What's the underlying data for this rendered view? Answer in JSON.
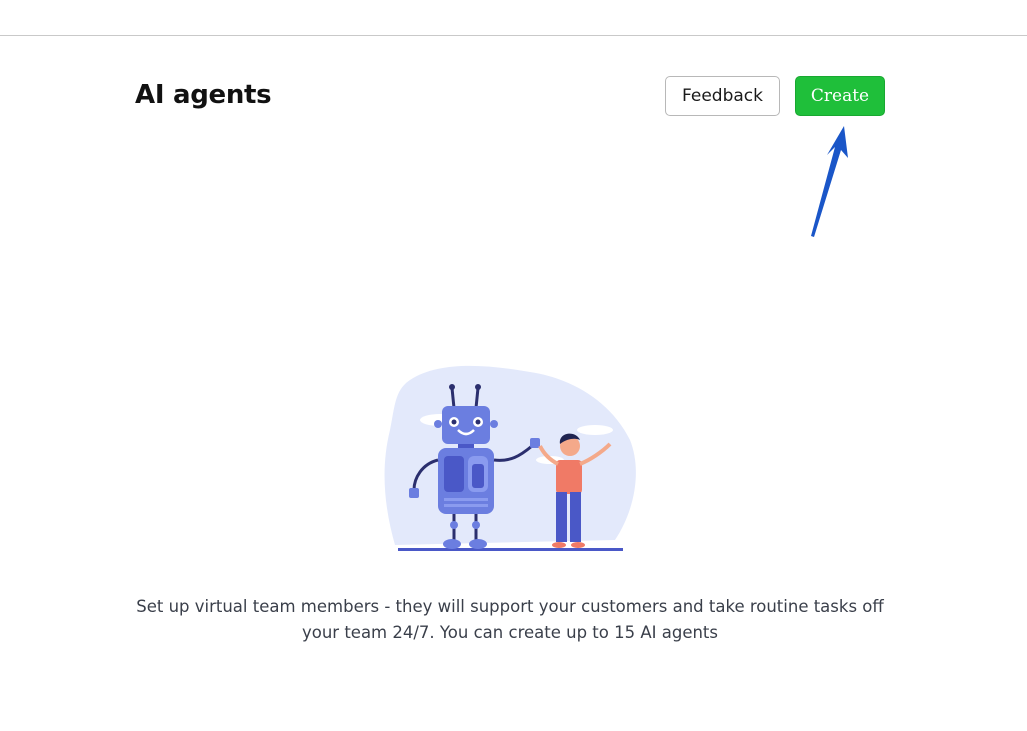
{
  "header": {
    "title": "AI agents",
    "feedback_label": "Feedback",
    "create_label": "Create"
  },
  "empty_state": {
    "message": "Set up virtual team members - they will support your customers and take routine tasks off your team 24/7. You can create up to 15 AI agents",
    "illustration": "robot-and-person-icon"
  },
  "colors": {
    "create_button": "#1fbf3a",
    "annotation_arrow": "#1a56c8",
    "illustration_primary": "#6b7ee0",
    "illustration_background": "#e3e9fb"
  }
}
